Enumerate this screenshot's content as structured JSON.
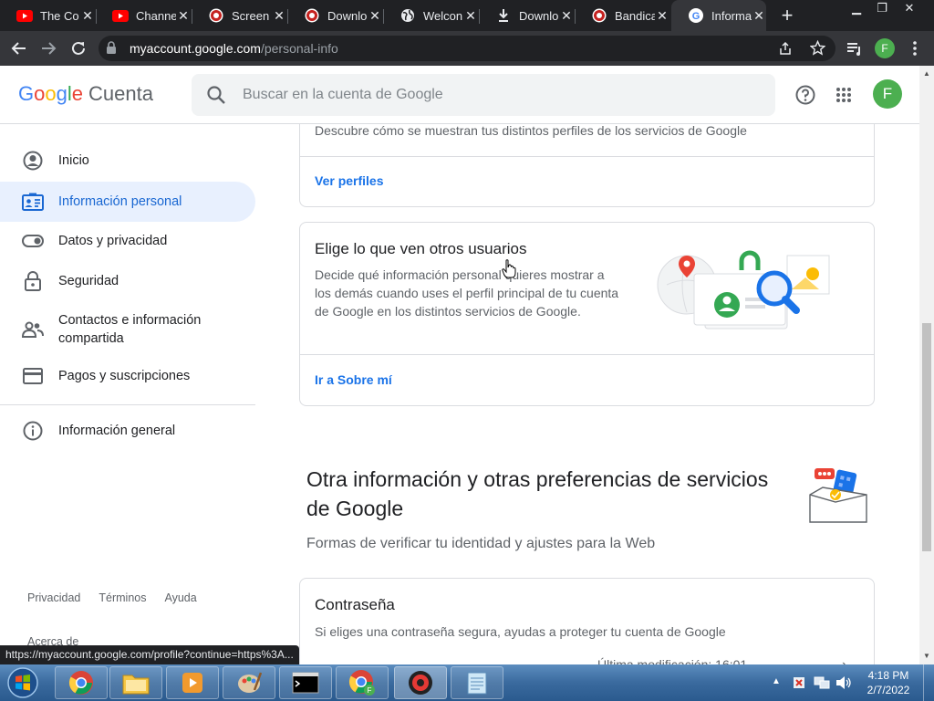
{
  "browser": {
    "tabs": [
      {
        "title": "The Co",
        "icon": "youtube-icon"
      },
      {
        "title": "Channe",
        "icon": "youtube-icon"
      },
      {
        "title": "Screen",
        "icon": "record-icon"
      },
      {
        "title": "Downlo",
        "icon": "record-icon"
      },
      {
        "title": "Welcon",
        "icon": "globe-icon"
      },
      {
        "title": "Downlo",
        "icon": "download-icon"
      },
      {
        "title": "Bandica",
        "icon": "record-icon"
      },
      {
        "title": "Informa",
        "icon": "google-icon"
      }
    ],
    "url_host": "myaccount.google.com",
    "url_path": "/personal-info",
    "profile_initial": "F"
  },
  "header": {
    "logo": "Google",
    "product": "Cuenta",
    "search_placeholder": "Buscar en la cuenta de Google",
    "avatar_initial": "F"
  },
  "sidebar": {
    "items": [
      {
        "label": "Inicio",
        "icon": "account-circle-icon"
      },
      {
        "label": "Información personal",
        "icon": "id-card-icon"
      },
      {
        "label": "Datos y privacidad",
        "icon": "toggle-icon"
      },
      {
        "label": "Seguridad",
        "icon": "lock-icon"
      },
      {
        "label": "Contactos e información compartida",
        "icon": "people-icon"
      },
      {
        "label": "Pagos y suscripciones",
        "icon": "credit-card-icon"
      },
      {
        "label": "Información general",
        "icon": "info-icon"
      }
    ],
    "footer": {
      "privacy": "Privacidad",
      "terms": "Términos",
      "help": "Ayuda",
      "about": "Acerca de"
    }
  },
  "main": {
    "profiles_card": {
      "desc": "Descubre cómo se muestran tus distintos perfiles de los servicios de Google",
      "link": "Ver perfiles"
    },
    "about_card": {
      "title": "Elige lo que ven otros usuarios",
      "desc": "Decide qué información personal quieres mostrar a los demás cuando uses el perfil principal de tu cuenta de Google en los distintos servicios de Google.",
      "link": "Ir a Sobre mí"
    },
    "other_section": {
      "title": "Otra información y otras preferencias de servicios de Google",
      "subtitle": "Formas de verificar tu identidad y ajustes para la Web"
    },
    "password_card": {
      "title": "Contraseña",
      "desc": "Si eliges una contraseña segura, ayudas a proteger tu cuenta de Google",
      "last_modified": "Última modificación: 16:01"
    }
  },
  "status_url": "https://myaccount.google.com/profile?continue=https%3A...",
  "taskbar": {
    "time": "4:18 PM",
    "date": "2/7/2022"
  }
}
